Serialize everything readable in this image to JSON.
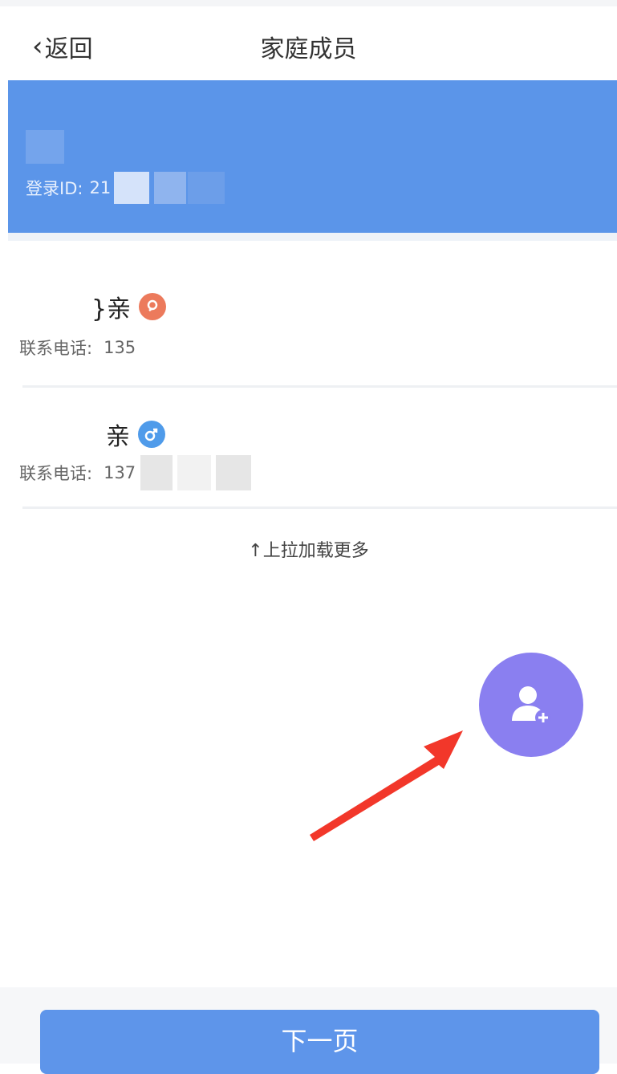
{
  "nav": {
    "back_label": "返回",
    "title": "家庭成员"
  },
  "profile": {
    "login_id_label": "登录ID:",
    "login_id_value": "21"
  },
  "members": [
    {
      "relation_suffix": "}亲",
      "gender_icon": "female-icon",
      "phone_label": "联系电话:",
      "phone_value": "135"
    },
    {
      "relation_suffix": "亲",
      "gender_icon": "male-icon",
      "phone_label": "联系电话:",
      "phone_value": "137"
    }
  ],
  "load_more": "↑上拉加载更多",
  "fab": {
    "icon": "add-user-icon",
    "color": "#8a7ff0"
  },
  "footer": {
    "next_label": "下一页"
  },
  "colors": {
    "accent": "#5b95e9",
    "button": "#5e95ea",
    "arrow": "#f2372a"
  }
}
